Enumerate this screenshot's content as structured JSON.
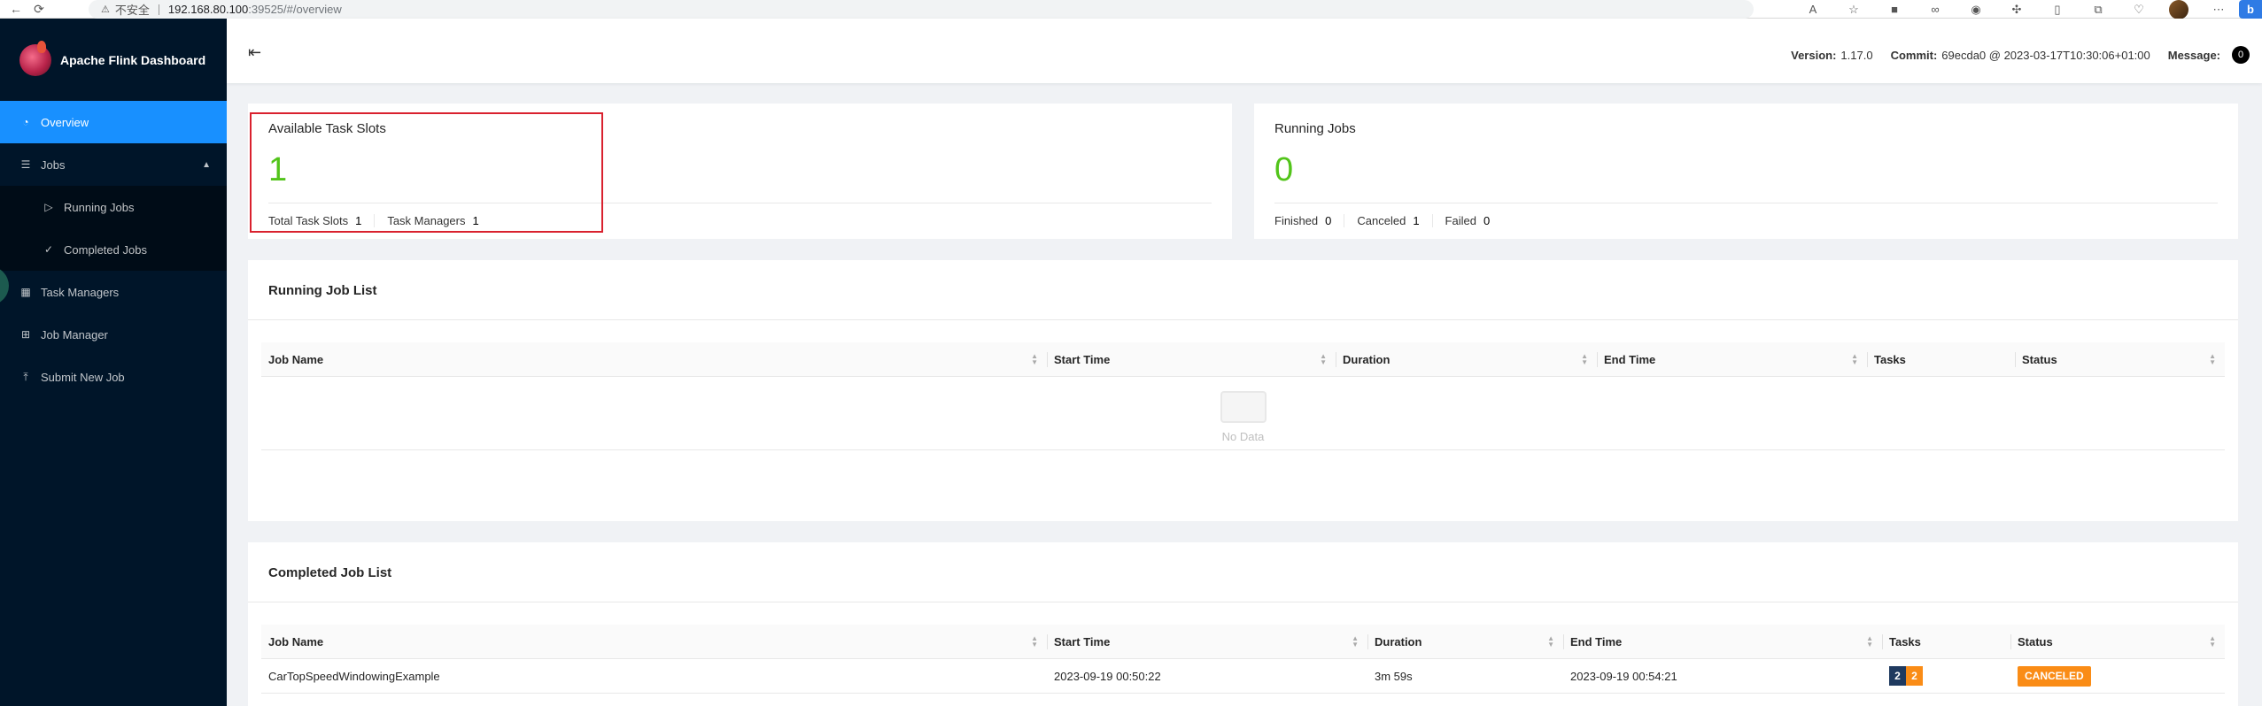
{
  "browser": {
    "insecure_label": "不安全",
    "url_host": "192.168.80.100",
    "url_path": ":39525/#/overview"
  },
  "sidebar": {
    "app_title": "Apache Flink Dashboard",
    "items": [
      {
        "label": "Overview",
        "icon": "dashboard-icon"
      },
      {
        "label": "Jobs",
        "icon": "list-icon"
      },
      {
        "label": "Running Jobs",
        "icon": "play-circle-icon"
      },
      {
        "label": "Completed Jobs",
        "icon": "check-circle-icon"
      },
      {
        "label": "Task Managers",
        "icon": "schedule-icon"
      },
      {
        "label": "Job Manager",
        "icon": "cluster-icon"
      },
      {
        "label": "Submit New Job",
        "icon": "upload-icon"
      }
    ]
  },
  "header": {
    "version_label": "Version:",
    "version_value": "1.17.0",
    "commit_label": "Commit:",
    "commit_value": "69ecda0 @ 2023-03-17T10:30:06+01:00",
    "message_label": "Message:",
    "message_count": "0"
  },
  "task_slots": {
    "title": "Available Task Slots",
    "value": "1",
    "total_label": "Total Task Slots",
    "total_value": "1",
    "tm_label": "Task Managers",
    "tm_value": "1"
  },
  "running_jobs": {
    "title": "Running Jobs",
    "value": "0",
    "finished_label": "Finished",
    "finished_value": "0",
    "canceled_label": "Canceled",
    "canceled_value": "1",
    "failed_label": "Failed",
    "failed_value": "0"
  },
  "running_list": {
    "title": "Running Job List",
    "columns": [
      "Job Name",
      "Start Time",
      "Duration",
      "End Time",
      "Tasks",
      "Status"
    ],
    "empty_text": "No Data"
  },
  "completed_list": {
    "title": "Completed Job List",
    "columns": [
      "Job Name",
      "Start Time",
      "Duration",
      "End Time",
      "Tasks",
      "Status"
    ],
    "rows": [
      {
        "job_name": "CarTopSpeedWindowingExample",
        "start_time": "2023-09-19 00:50:22",
        "duration": "3m 59s",
        "end_time": "2023-09-19 00:54:21",
        "tasks": [
          "2",
          "2"
        ],
        "status": "CANCELED"
      }
    ]
  },
  "colors": {
    "sidebar_bg": "#001529",
    "accent": "#1890ff",
    "green": "#52c41a",
    "status_canceled": "#fa8c16",
    "task_total": "#1f3a5f",
    "task_canceled": "#fa8c16"
  }
}
